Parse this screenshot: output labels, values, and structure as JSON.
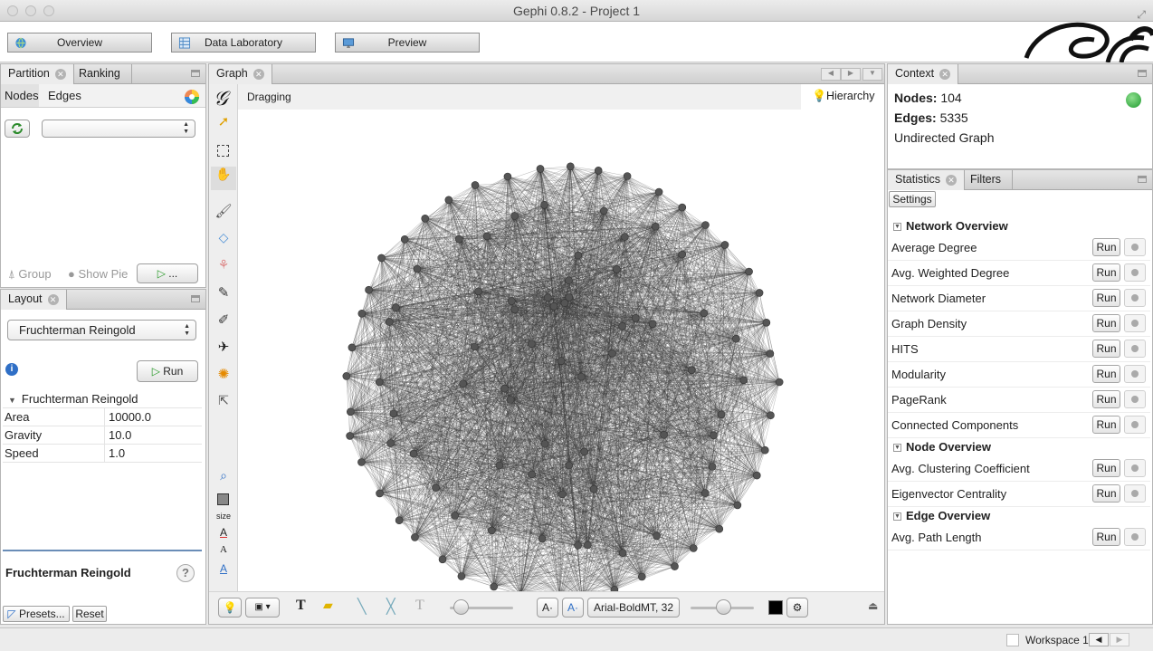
{
  "window": {
    "title": "Gephi 0.8.2 - Project 1"
  },
  "toolbar": {
    "overview": "Overview",
    "data_laboratory": "Data Laboratory",
    "preview": "Preview"
  },
  "partition": {
    "tab_partition": "Partition",
    "tab_ranking": "Ranking",
    "nodes": "Nodes",
    "edges": "Edges",
    "select_value": "",
    "group": "Group",
    "show_pie": "Show Pie",
    "apply": "..."
  },
  "layout": {
    "tab": "Layout",
    "algorithm": "Fruchterman Reingold",
    "run": "Run",
    "props_header": "Fruchterman Reingold",
    "props": [
      {
        "key": "Area",
        "value": "10000.0"
      },
      {
        "key": "Gravity",
        "value": "10.0"
      },
      {
        "key": "Speed",
        "value": "1.0"
      }
    ],
    "desc_title": "Fruchterman Reingold",
    "presets": "Presets...",
    "reset": "Reset"
  },
  "graph": {
    "tab": "Graph",
    "mode": "Dragging",
    "hierarchy": "Hierarchy",
    "font": "Arial-BoldMT, 32",
    "size_label": "size",
    "node_color": "#555555",
    "edge_color": "#3a3a3a",
    "node_count": 104
  },
  "context": {
    "tab": "Context",
    "nodes_label": "Nodes:",
    "nodes_value": "104",
    "edges_label": "Edges:",
    "edges_value": "5335",
    "type": "Undirected Graph"
  },
  "statistics": {
    "tab_statistics": "Statistics",
    "tab_filters": "Filters",
    "settings": "Settings",
    "sections": [
      {
        "title": "Network Overview",
        "items": [
          "Average Degree",
          "Avg. Weighted Degree",
          "Network Diameter",
          "Graph Density",
          "HITS",
          "Modularity",
          "PageRank",
          "Connected Components"
        ]
      },
      {
        "title": "Node Overview",
        "items": [
          "Avg. Clustering Coefficient",
          "Eigenvector Centrality"
        ]
      },
      {
        "title": "Edge Overview",
        "items": [
          "Avg. Path Length"
        ]
      }
    ],
    "run_label": "Run"
  },
  "statusbar": {
    "workspace": "Workspace 1"
  }
}
